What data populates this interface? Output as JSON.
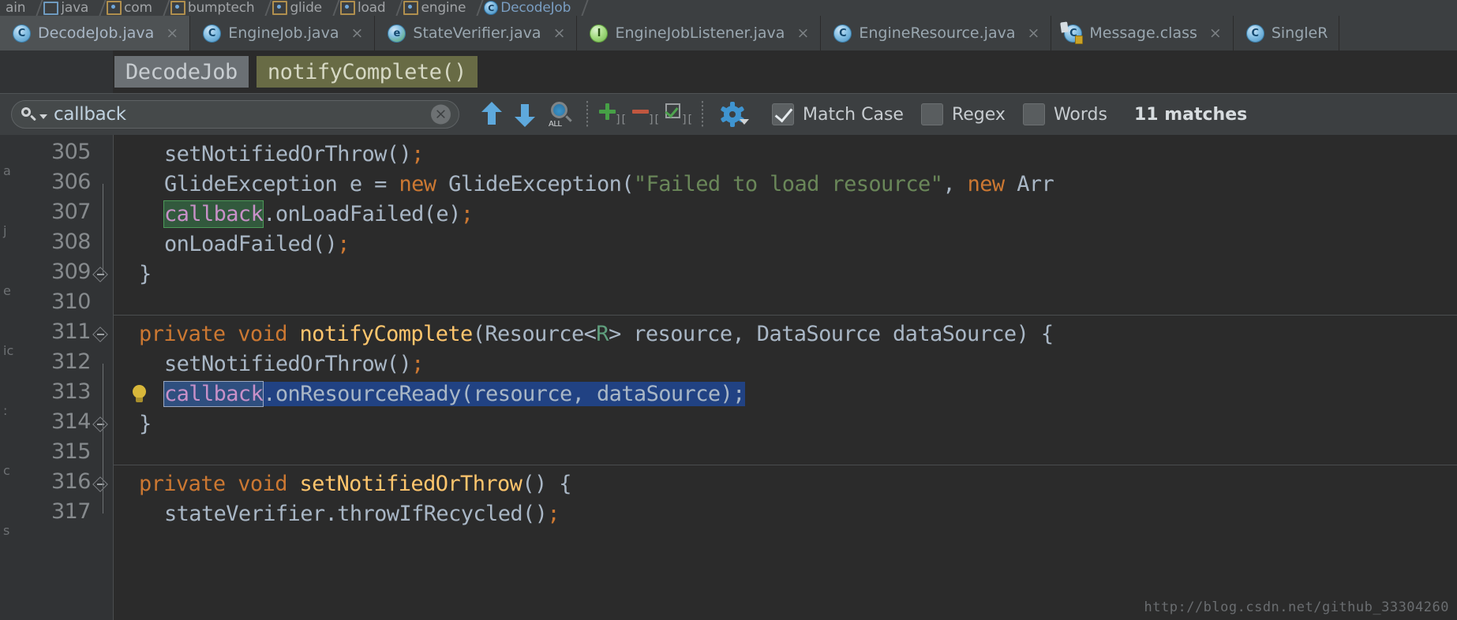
{
  "navbar": {
    "crumbs": [
      {
        "label": "ain",
        "icon": "none"
      },
      {
        "label": "java",
        "icon": "folder-icon"
      },
      {
        "label": "com",
        "icon": "package-icon"
      },
      {
        "label": "bumptech",
        "icon": "package-icon"
      },
      {
        "label": "glide",
        "icon": "package-icon"
      },
      {
        "label": "load",
        "icon": "package-icon"
      },
      {
        "label": "engine",
        "icon": "package-icon"
      },
      {
        "label": "DecodeJob",
        "icon": "class-icon",
        "selected": true
      }
    ]
  },
  "tabs": [
    {
      "label": "DecodeJob.java",
      "icon": "java-class-icon",
      "kind": "cls",
      "active": true,
      "close": "×"
    },
    {
      "label": "EngineJob.java",
      "icon": "java-class-icon",
      "kind": "cls",
      "active": false,
      "close": "×"
    },
    {
      "label": "StateVerifier.java",
      "icon": "java-enum-icon",
      "kind": "enumi",
      "active": false,
      "close": "×"
    },
    {
      "label": "EngineJobListener.java",
      "icon": "java-interface-icon",
      "kind": "iface",
      "active": false,
      "close": "×"
    },
    {
      "label": "EngineResource.java",
      "icon": "java-class-icon",
      "kind": "cls",
      "active": false,
      "close": "×"
    },
    {
      "label": "Message.class",
      "icon": "compiled-class-icon",
      "kind": "clsfile",
      "active": false,
      "close": "×"
    },
    {
      "label": "SingleR",
      "icon": "java-class-icon",
      "kind": "cls",
      "active": false,
      "close": ""
    }
  ],
  "chips": {
    "class_chip": "DecodeJob",
    "method_chip": "notifyComplete()"
  },
  "find_toolbar": {
    "search_value": "callback",
    "search_placeholder": "Find",
    "clear_icon": "×",
    "buttons": [
      {
        "name": "find-previous-icon",
        "title": "Previous Occurrence"
      },
      {
        "name": "find-next-icon",
        "title": "Next Occurrence"
      },
      {
        "name": "find-all-icon",
        "title": "Find All",
        "label": "ALL"
      },
      {
        "name": "add-selection-icon",
        "title": "Select All Occurrences"
      },
      {
        "name": "remove-selection-icon",
        "title": "Remove Occurrence"
      },
      {
        "name": "select-all-occurrences-icon",
        "title": "Select All"
      },
      {
        "name": "find-settings-gear-icon",
        "title": "Filter Options"
      }
    ],
    "options": [
      {
        "label": "Match Case",
        "checked": true
      },
      {
        "label": "Regex",
        "checked": false
      },
      {
        "label": "Words",
        "checked": false
      }
    ],
    "match_count": "11 matches"
  },
  "editor": {
    "left_strip_marks": [
      "a",
      "j",
      "e",
      "ic",
      ":",
      "c",
      "s"
    ],
    "lines": [
      {
        "no": "305",
        "indent": 2,
        "segments": [
          {
            "t": "setNotifiedOrThrow()",
            "c": ""
          },
          {
            "t": ";",
            "c": "semi"
          }
        ]
      },
      {
        "no": "306",
        "indent": 2,
        "segments": [
          {
            "t": "GlideException e = ",
            "c": ""
          },
          {
            "t": "new",
            "c": "kw"
          },
          {
            "t": " GlideException(",
            "c": ""
          },
          {
            "t": "\"Failed to load resource\"",
            "c": "str"
          },
          {
            "t": ", ",
            "c": ""
          },
          {
            "t": "new",
            "c": "kw"
          },
          {
            "t": " Arr",
            "c": ""
          }
        ]
      },
      {
        "no": "307",
        "indent": 2,
        "segments": [
          {
            "t": "callback",
            "c": "hl-find"
          },
          {
            "t": ".onLoadFailed(e)",
            "c": ""
          },
          {
            "t": ";",
            "c": "semi"
          }
        ]
      },
      {
        "no": "308",
        "indent": 2,
        "segments": [
          {
            "t": "onLoadFailed()",
            "c": ""
          },
          {
            "t": ";",
            "c": "semi"
          }
        ]
      },
      {
        "no": "309",
        "indent": 1,
        "fold": "collapse",
        "segments": [
          {
            "t": "}",
            "c": ""
          }
        ]
      },
      {
        "no": "310",
        "indent": 0,
        "segments": []
      },
      {
        "no": "311",
        "indent": 1,
        "fold": "expand",
        "separator": true,
        "segments": [
          {
            "t": "private void ",
            "c": "kw"
          },
          {
            "t": "notifyComplete",
            "c": "mname"
          },
          {
            "t": "(Resource<",
            "c": ""
          },
          {
            "t": "R",
            "c": "gen"
          },
          {
            "t": "> resource, DataSource dataSource) {",
            "c": ""
          }
        ]
      },
      {
        "no": "312",
        "indent": 2,
        "segments": [
          {
            "t": "setNotifiedOrThrow()",
            "c": ""
          },
          {
            "t": ";",
            "c": "semi"
          }
        ]
      },
      {
        "no": "313",
        "indent": 2,
        "bulb": true,
        "segments": [
          {
            "t": "callback",
            "c": "hl-sel-token"
          },
          {
            "t": ".onResourceReady(resource, dataSource);",
            "c": "hl-sel"
          }
        ]
      },
      {
        "no": "314",
        "indent": 1,
        "fold": "collapse",
        "segments": [
          {
            "t": "}",
            "c": ""
          }
        ]
      },
      {
        "no": "315",
        "indent": 0,
        "segments": []
      },
      {
        "no": "316",
        "indent": 1,
        "fold": "expand",
        "separator": true,
        "segments": [
          {
            "t": "private void ",
            "c": "kw"
          },
          {
            "t": "setNotifiedOrThrow",
            "c": "mname"
          },
          {
            "t": "() {",
            "c": ""
          }
        ]
      },
      {
        "no": "317",
        "indent": 2,
        "segments": [
          {
            "t": "stateVerifier.throwIfRecycled()",
            "c": ""
          },
          {
            "t": ";",
            "c": "semi"
          }
        ]
      }
    ]
  },
  "watermark": "http://blog.csdn.net/github_33304260"
}
